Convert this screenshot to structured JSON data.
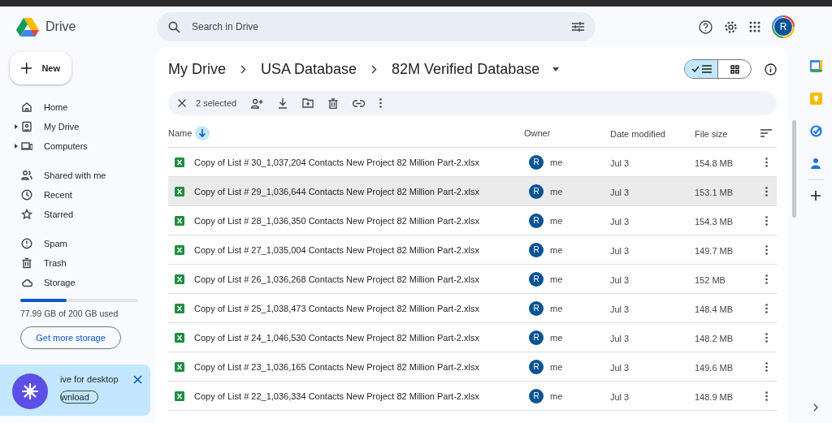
{
  "app": {
    "name": "Drive"
  },
  "search": {
    "placeholder": "Search in Drive"
  },
  "account": {
    "initial": "R"
  },
  "new_button": {
    "label": "New"
  },
  "sidebar": {
    "items": [
      {
        "label": "Home",
        "expandable": false
      },
      {
        "label": "My Drive",
        "expandable": true
      },
      {
        "label": "Computers",
        "expandable": true
      },
      {
        "label": "Shared with me",
        "expandable": false
      },
      {
        "label": "Recent",
        "expandable": false
      },
      {
        "label": "Starred",
        "expandable": false
      },
      {
        "label": "Spam",
        "expandable": false
      },
      {
        "label": "Trash",
        "expandable": false
      },
      {
        "label": "Storage",
        "expandable": false
      }
    ]
  },
  "storage": {
    "level": 0.39,
    "text": "77.99 GB of 200 GB used",
    "button": "Get more storage"
  },
  "promo": {
    "title": "ive for desktop",
    "button": "wnload"
  },
  "breadcrumb": [
    "My Drive",
    "USA Database",
    "82M Verified Database"
  ],
  "view_options": [
    {
      "kind": "list",
      "selected": true
    },
    {
      "kind": "grid",
      "selected": false
    }
  ],
  "selection_bar": {
    "count": "2 selected"
  },
  "table": {
    "columns": [
      "Name",
      "Owner",
      "Date modified",
      "File size"
    ],
    "rows": [
      {
        "name": "Copy of List # 30_1,037,204 Contacts New Project 82 Million Part-2.xlsx",
        "owner_initial": "R",
        "owner": "me",
        "modified": "Jul 3",
        "size": "154.8 MB",
        "selected": false
      },
      {
        "name": "Copy of List # 29_1,036,644 Contacts New Project 82 Million Part-2.xlsx",
        "owner_initial": "R",
        "owner": "me",
        "modified": "Jul 3",
        "size": "153.1 MB",
        "selected": true
      },
      {
        "name": "Copy of List # 28_1,036,350 Contacts New Project 82 Million Part-2.xlsx",
        "owner_initial": "R",
        "owner": "me",
        "modified": "Jul 3",
        "size": "154.3 MB",
        "selected": false
      },
      {
        "name": "Copy of List # 27_1,035,004 Contacts New Project 82 Million Part-2.xlsx",
        "owner_initial": "R",
        "owner": "me",
        "modified": "Jul 3",
        "size": "149.7 MB",
        "selected": false
      },
      {
        "name": "Copy of List # 26_1,036,268 Contacts New Project 82 Million Part-2.xlsx",
        "owner_initial": "R",
        "owner": "me",
        "modified": "Jul 3",
        "size": "152 MB",
        "selected": false
      },
      {
        "name": "Copy of List # 25_1,038,473 Contacts New Project 82 Million Part-2.xlsx",
        "owner_initial": "R",
        "owner": "me",
        "modified": "Jul 3",
        "size": "148.4 MB",
        "selected": false
      },
      {
        "name": "Copy of List # 24_1,046,530 Contacts New Project 82 Million Part-2.xlsx",
        "owner_initial": "R",
        "owner": "me",
        "modified": "Jul 3",
        "size": "148.2 MB",
        "selected": false
      },
      {
        "name": "Copy of List # 23_1,036,165 Contacts New Project 82 Million Part-2.xlsx",
        "owner_initial": "R",
        "owner": "me",
        "modified": "Jul 3",
        "size": "149.6 MB",
        "selected": false
      },
      {
        "name": "Copy of List # 22_1,036,334 Contacts New Project 82 Million Part-2.xlsx",
        "owner_initial": "R",
        "owner": "me",
        "modified": "Jul 3",
        "size": "148.9 MB",
        "selected": false
      }
    ]
  }
}
